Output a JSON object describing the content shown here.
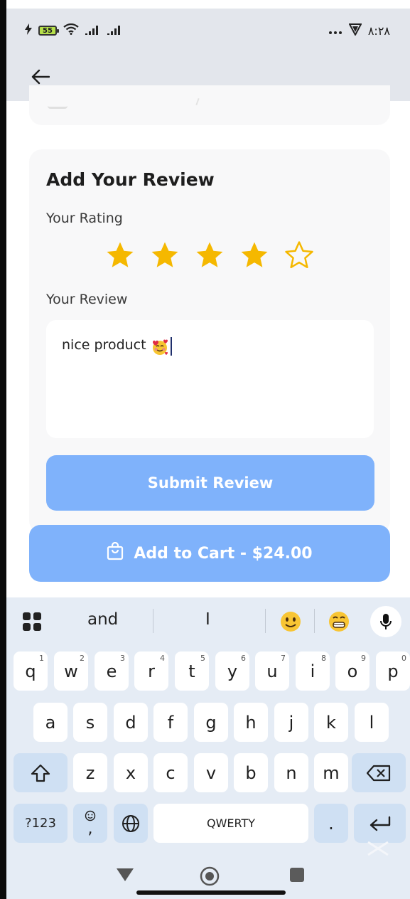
{
  "status_bar": {
    "battery_level": "55",
    "left_icons": [
      "charging-icon",
      "battery-icon",
      "wifi-icon",
      "signal-icon",
      "signal-icon"
    ],
    "right_icons": [
      "more-dots-icon",
      "vpn-shield-icon"
    ],
    "time": "٨:٢٨"
  },
  "header": {
    "back_icon": "arrow-left-icon"
  },
  "review": {
    "title": "Add Your Review",
    "rating_label": "Your Rating",
    "rating": 4,
    "rating_max": 5,
    "review_label": "Your Review",
    "review_text": "nice product",
    "review_emoji": "smiling-face-with-hearts-icon",
    "submit_label": "Submit Review"
  },
  "cart": {
    "label": "Add to Cart - $24.00",
    "icon": "shopping-bag-icon"
  },
  "colors": {
    "primary_light": "#7fb2fb",
    "star": "#f5b800",
    "header_bg": "#e3e6ec",
    "keyboard_bg": "#e5ecf5"
  },
  "keyboard": {
    "suggestions": [
      "and",
      "I"
    ],
    "emoji_suggestions": [
      "slightly-smiling-face-icon",
      "grinning-face-icon"
    ],
    "row1": [
      "q",
      "w",
      "e",
      "r",
      "t",
      "y",
      "u",
      "i",
      "o",
      "p"
    ],
    "row1_hints": [
      "1",
      "2",
      "3",
      "4",
      "5",
      "6",
      "7",
      "8",
      "9",
      "0"
    ],
    "row2": [
      "a",
      "s",
      "d",
      "f",
      "g",
      "h",
      "j",
      "k",
      "l"
    ],
    "row3": [
      "z",
      "x",
      "c",
      "v",
      "b",
      "n",
      "m"
    ],
    "symbols_label": "?123",
    "emoji_comma": ",",
    "space_label": "QWERTY",
    "period_label": "."
  }
}
